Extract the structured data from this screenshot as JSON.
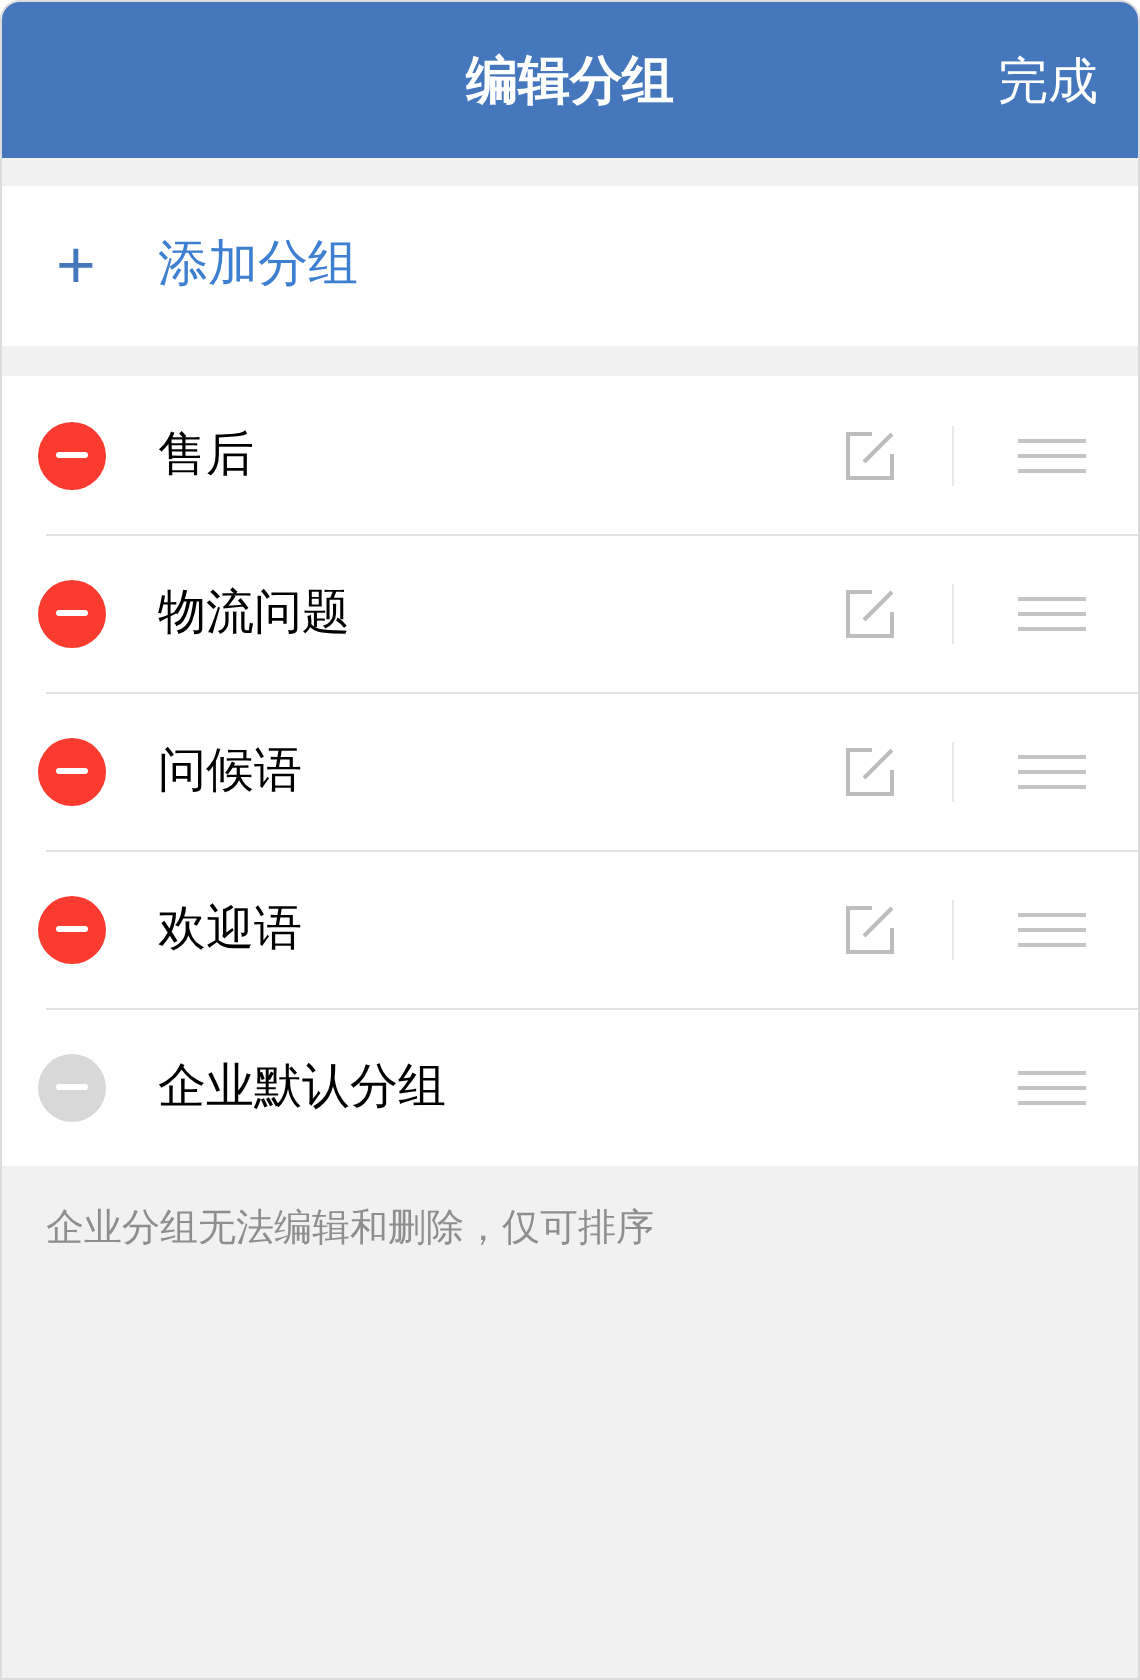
{
  "header": {
    "title": "编辑分组",
    "done": "完成"
  },
  "add_group": {
    "plus": "+",
    "label": "添加分组"
  },
  "groups": [
    {
      "name": "售后",
      "editable": true
    },
    {
      "name": "物流问题",
      "editable": true
    },
    {
      "name": "问候语",
      "editable": true
    },
    {
      "name": "欢迎语",
      "editable": true
    },
    {
      "name": "企业默认分组",
      "editable": false
    }
  ],
  "footer_note": "企业分组无法编辑和删除，仅可排序"
}
